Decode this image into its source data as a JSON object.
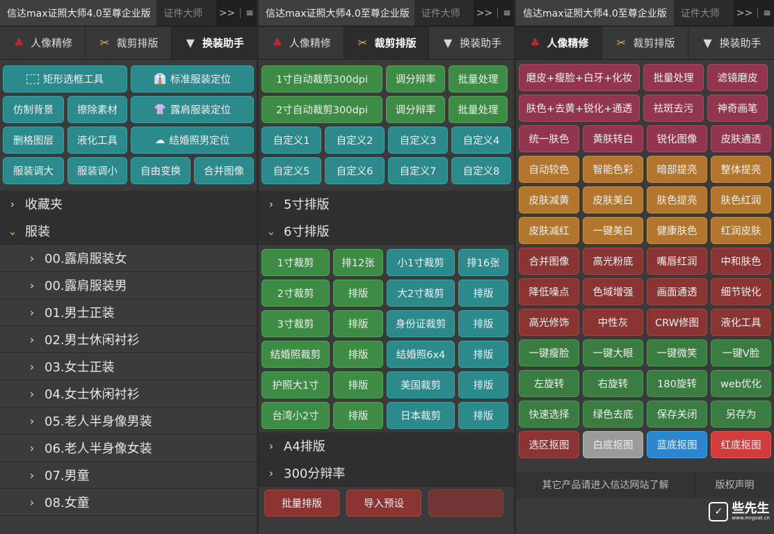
{
  "panels": [
    {
      "title": "信达max证照大师4.0至尊企业版",
      "tab2": "证件大师",
      "more": ">>",
      "menu": "≡",
      "subtabs": [
        "人像精修",
        "裁剪排版",
        "换装助手"
      ]
    },
    {
      "title": "信达max证照大师4.0至尊企业版",
      "tab2": "证件大师",
      "more": ">>",
      "menu": "≡",
      "subtabs": [
        "人像精修",
        "裁剪排版",
        "换装助手"
      ]
    },
    {
      "title": "信达max证照大师4.0至尊企业版",
      "tab2": "证件大师",
      "more": ">>",
      "menu": "≡",
      "subtabs": [
        "人像精修",
        "裁剪排版",
        "换装助手"
      ]
    }
  ],
  "p1": {
    "tools": [
      "矩形选框工具",
      "标准服装定位",
      "仿制背景",
      "擦除素材",
      "露肩服装定位",
      "删格图层",
      "液化工具",
      "结婚照男定位",
      "服装调大",
      "服装调小",
      "自由变换",
      "合并图像"
    ],
    "tree": [
      {
        "label": "收藏夹",
        "expanded": false
      },
      {
        "label": "服装",
        "expanded": true
      },
      {
        "label": "00.露肩服装女"
      },
      {
        "label": "00.露肩服装男"
      },
      {
        "label": "01.男士正装"
      },
      {
        "label": "02.男士休闲衬衫"
      },
      {
        "label": "03.女士正装"
      },
      {
        "label": "04.女士休闲衬衫"
      },
      {
        "label": "05.老人半身像男装"
      },
      {
        "label": "06.老人半身像女装"
      },
      {
        "label": "07.男童"
      },
      {
        "label": "08.女童"
      }
    ]
  },
  "p2": {
    "top": [
      "1寸自动裁剪300dpi",
      "调分辩率",
      "批量处理",
      "2寸自动裁剪300dpi",
      "调分辩率",
      "批量处理"
    ],
    "custom": [
      "自定义1",
      "自定义2",
      "自定义3",
      "自定义4",
      "自定义5",
      "自定义6",
      "自定义7",
      "自定义8"
    ],
    "sec5": "5寸排版",
    "sec6": "6寸排版",
    "six": [
      "1寸裁剪",
      "排12张",
      "小1寸裁剪",
      "排16张",
      "2寸裁剪",
      "排版",
      "大2寸裁剪",
      "排版",
      "3寸裁剪",
      "排版",
      "身份证裁剪",
      "排版",
      "结婚照裁剪",
      "排版",
      "结婚照6x4",
      "排版",
      "护照大1寸",
      "排版",
      "美国裁剪",
      "排版",
      "台湾小2寸",
      "排版",
      "日本裁剪",
      "排版"
    ],
    "secA4": "A4排版",
    "sec300": "300分辩率",
    "bottom": [
      "批量排版",
      "导入预设",
      ""
    ]
  },
  "p3": {
    "buttons": [
      "磨皮+瘦脸+白牙+化妆",
      "批量处理",
      "滤镜磨皮",
      "肤色+去黄+锐化+通透",
      "祛斑去污",
      "神奇画笔",
      "统一肤色",
      "黄肤转白",
      "锐化图像",
      "皮肤通透",
      "自动较色",
      "智能色彩",
      "暗部提亮",
      "整体提亮",
      "皮肤减黄",
      "皮肤美白",
      "肤色提亮",
      "肤色红润",
      "皮肤减红",
      "一键美白",
      "健康肤色",
      "红润皮肤",
      "合并图像",
      "高光粉底",
      "嘴唇红润",
      "中和肤色",
      "降低噪点",
      "色域增强",
      "画面通透",
      "细节锐化",
      "高光修饰",
      "中性灰",
      "CRW修图",
      "液化工具",
      "一键瘦脸",
      "一键大眼",
      "一键微笑",
      "一键V脸",
      "左旋转",
      "右旋转",
      "180旋转",
      "web优化",
      "快速选择",
      "绿色去底",
      "保存关闭",
      "另存为",
      "选区抠图",
      "白底抠图",
      "蓝底抠图",
      "红底抠图"
    ],
    "footer_left": "其它产品请进入信达网站了解",
    "footer_right": "版权声明"
  },
  "watermark": {
    "title": "些先生",
    "url": "www.mrgoat.cn"
  },
  "colors": {
    "teal": "#2c8a8c",
    "green": "#3e8b45",
    "maroon": "#92354e",
    "orange": "#b2762f",
    "dred": "#8a3434",
    "gray": "#9b9b9b",
    "blue": "#2b86cf",
    "red": "#d23c3c"
  }
}
